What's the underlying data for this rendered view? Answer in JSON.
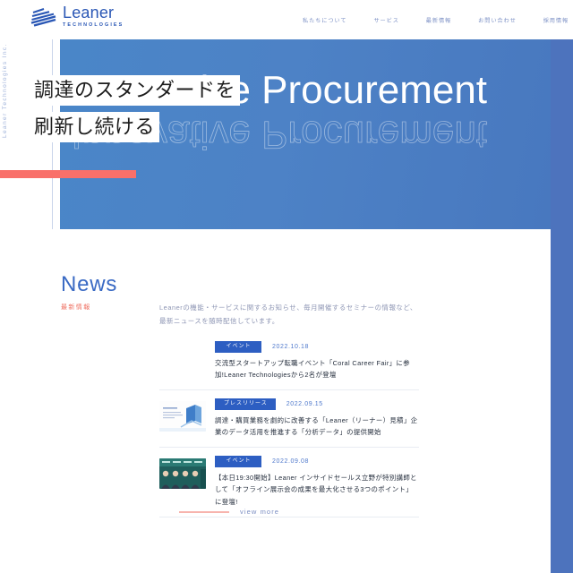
{
  "side_label": "Leaner Technologies Inc.",
  "header": {
    "logo": {
      "word": "Leaner",
      "sub": "TECHNOLOGIES",
      "icon": "leaner-mark-icon"
    },
    "nav": [
      {
        "label": "私たちについて"
      },
      {
        "label": "サービス"
      },
      {
        "label": "最新情報"
      },
      {
        "label": "お問い合わせ"
      },
      {
        "label": "採用情報"
      }
    ]
  },
  "hero": {
    "headline_line1": "調達のスタンダードを",
    "headline_line2": "刷新し続ける",
    "big_text": "er Innovative Procurement",
    "mirror_text": "er Innovative Procurement",
    "bar_color": "#f9706a",
    "panel_color": "#4a80c5"
  },
  "news": {
    "title": "News",
    "subtitle": "最新情報",
    "description_line1": "Leanerの機能・サービスに関するお知らせ、毎月開催するセミナーの情報など、",
    "description_line2": "最新ニュースを随時配信しています。",
    "items": [
      {
        "category": "イベント",
        "date": "2022.10.18",
        "title": "交流型スタートアップ転職イベント「Coral Career Fair」に参加!Leaner Technologiesから2名が登壇",
        "thumbnail": "none"
      },
      {
        "category": "プレスリリース",
        "date": "2022.09.15",
        "title": "調達・購買業務を劇的に改善する「Leaner（リーナー）見積」企業のデータ活用を推進する「分析データ」の提供開始",
        "thumbnail": "chart-document-image"
      },
      {
        "category": "イベント",
        "date": "2022.09.08",
        "title": "【本日19:30開始】Leaner インサイドセールス立野が特別講師として「オフライン展示会の成果を最大化させる3つのポイント」に登壇!",
        "thumbnail": "team-photo-image"
      }
    ],
    "view_more": "view more",
    "badge_color": "#2d5ec2",
    "accent_color": "#ef7062"
  }
}
